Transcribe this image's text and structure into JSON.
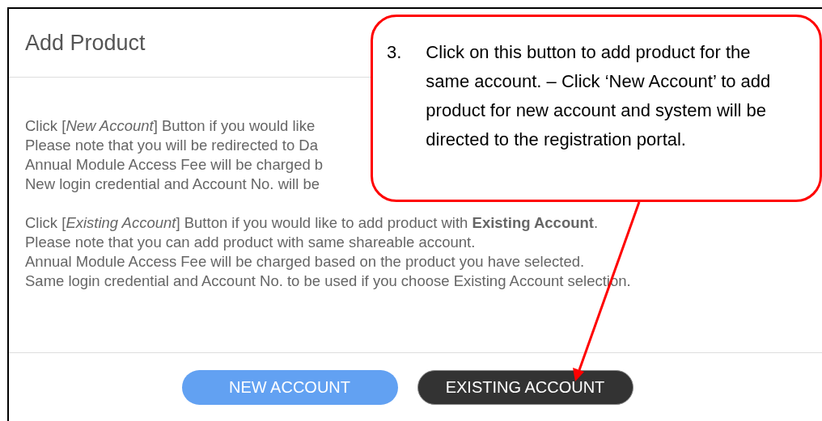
{
  "dialog": {
    "title": "Add Product",
    "paragraphs": [
      [
        "Click [*New Account*] Button if you would like",
        "Please note that you will be redirected to Da",
        "Annual Module Access Fee will be charged b",
        "New login credential and Account No. will be"
      ],
      [
        "Click [*Existing Account*] Button if you would like to add product with **Existing Account**.",
        "Please note that you can add product with same shareable account.",
        "Annual Module Access Fee will be charged based on the product you have selected.",
        "Same login credential and Account No. to be used if you choose Existing Account selection."
      ]
    ],
    "buttons": [
      {
        "label": "NEW ACCOUNT",
        "kind": "primary"
      },
      {
        "label": "EXISTING ACCOUNT",
        "kind": "dark"
      }
    ]
  },
  "callout": {
    "number": "3.",
    "text": "Click on this button to add product for the same account. – Click ‘New Account’ to add product for new account and system will be directed to the registration portal."
  }
}
